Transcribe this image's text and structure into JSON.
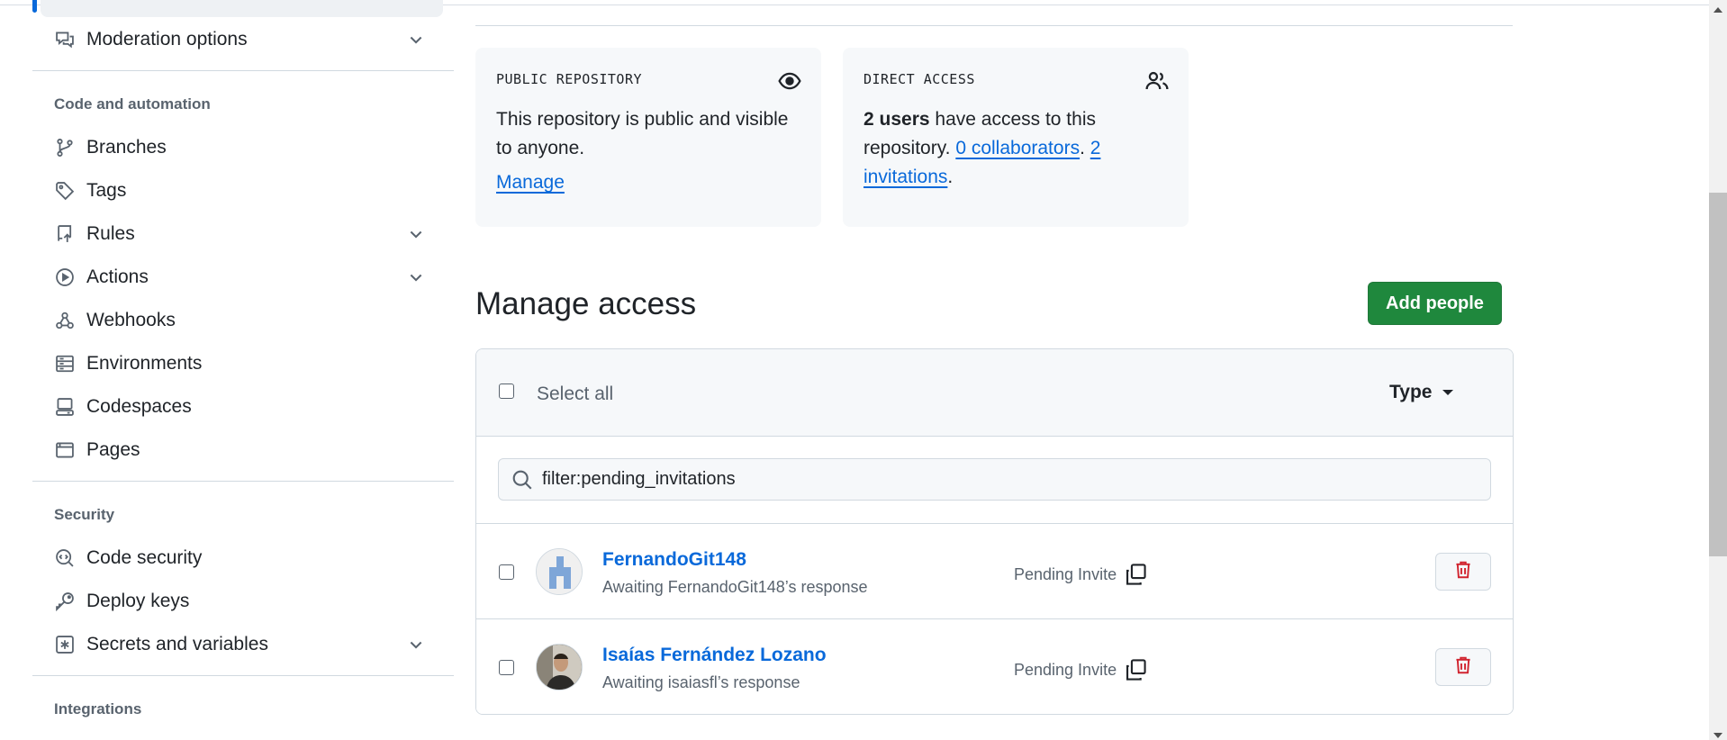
{
  "sidebar": {
    "items_top": [
      {
        "label": "Moderation options",
        "icon": "comment-discussion-icon",
        "expandable": true
      }
    ],
    "sections": [
      {
        "heading": "Code and automation",
        "items": [
          {
            "label": "Branches",
            "icon": "git-branch-icon",
            "expandable": false
          },
          {
            "label": "Tags",
            "icon": "tag-icon",
            "expandable": false
          },
          {
            "label": "Rules",
            "icon": "repo-push-icon",
            "expandable": true
          },
          {
            "label": "Actions",
            "icon": "play-icon",
            "expandable": true
          },
          {
            "label": "Webhooks",
            "icon": "webhook-icon",
            "expandable": false
          },
          {
            "label": "Environments",
            "icon": "server-icon",
            "expandable": false
          },
          {
            "label": "Codespaces",
            "icon": "codespaces-icon",
            "expandable": false
          },
          {
            "label": "Pages",
            "icon": "browser-icon",
            "expandable": false
          }
        ]
      },
      {
        "heading": "Security",
        "items": [
          {
            "label": "Code security",
            "icon": "codescan-icon",
            "expandable": false
          },
          {
            "label": "Deploy keys",
            "icon": "key-icon",
            "expandable": false
          },
          {
            "label": "Secrets and variables",
            "icon": "key-asterisk-icon",
            "expandable": true
          }
        ]
      },
      {
        "heading": "Integrations",
        "items": []
      }
    ]
  },
  "cards": {
    "public": {
      "label": "PUBLIC REPOSITORY",
      "icon": "eye-icon",
      "text": "This repository is public and visible to anyone.",
      "link": "Manage"
    },
    "direct": {
      "label": "DIRECT ACCESS",
      "icon": "people-icon",
      "users_bold": "2 users",
      "text_after": " have access to this repository. ",
      "collaborators_link": "0 collaborators",
      "sep": ". ",
      "invitations_link": "2 invitations",
      "end": "."
    }
  },
  "manage": {
    "title": "Manage access",
    "add_button": "Add people",
    "select_all": "Select all",
    "type_dropdown": "Type",
    "search_value": "filter:pending_invitations"
  },
  "members": [
    {
      "name": "FernandoGit148",
      "subtitle": "Awaiting FernandoGit148’s response",
      "status": "Pending Invite",
      "avatar": "identicon"
    },
    {
      "name": "Isaías Fernández Lozano",
      "subtitle": "Awaiting isaiasfl’s response",
      "status": "Pending Invite",
      "avatar": "photo"
    }
  ],
  "colors": {
    "accent": "#0969da",
    "primary_button": "#1f883d",
    "danger": "#d1242f",
    "muted_text": "#59636e",
    "canvas_subtle": "#f6f8fa",
    "border": "#d1d9e0"
  }
}
